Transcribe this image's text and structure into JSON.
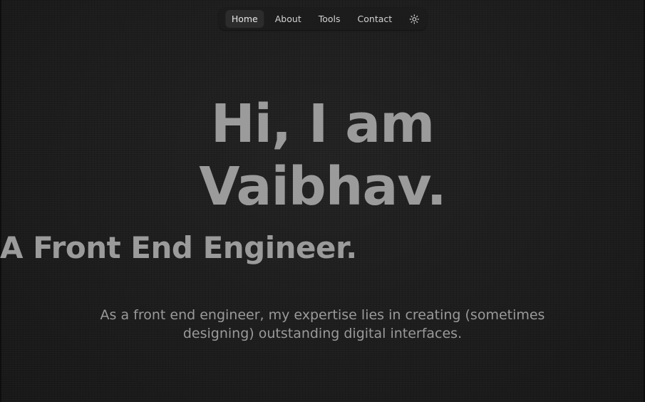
{
  "nav": {
    "items": [
      {
        "label": "Home",
        "active": true
      },
      {
        "label": "About",
        "active": false
      },
      {
        "label": "Tools",
        "active": false
      },
      {
        "label": "Contact",
        "active": false
      }
    ],
    "theme_toggle_icon": "sun-icon"
  },
  "hero": {
    "greeting": "Hi, I am",
    "name": "Vaibhav.",
    "role": "A Front End Engineer.",
    "description_line1": "As a front end engineer, my expertise lies in creating (sometimes",
    "description_line2": "designing) outstanding digital interfaces."
  },
  "colors": {
    "background": "#1c1c1c",
    "hero_text": "#9b9b9b",
    "nav_text": "#d2d2d2",
    "nav_active_bg": "#2c2c2c"
  }
}
